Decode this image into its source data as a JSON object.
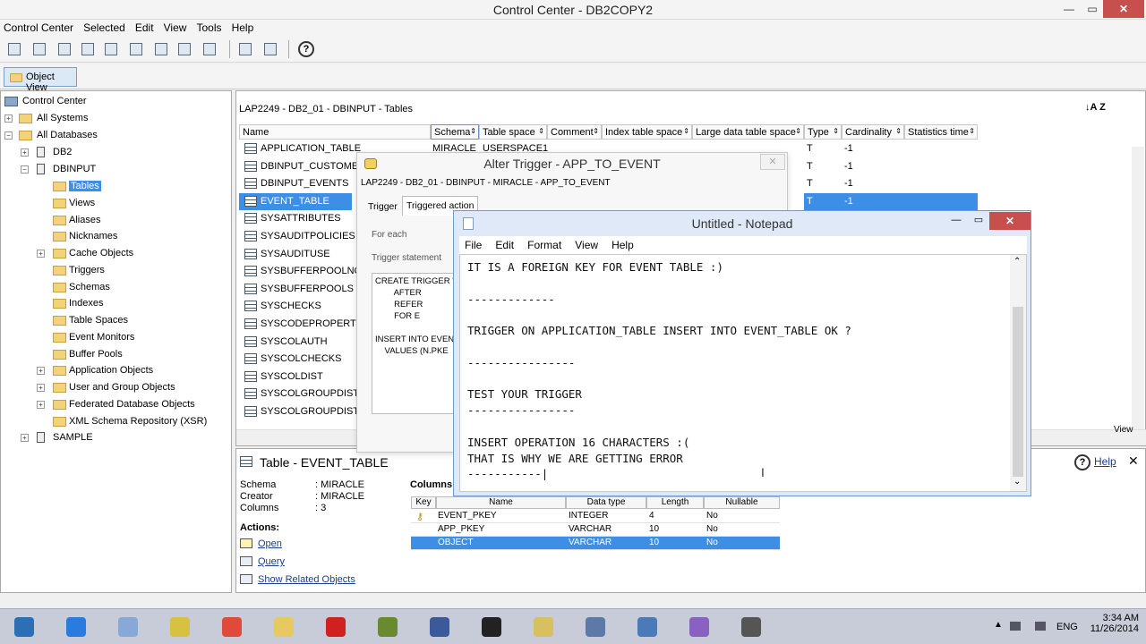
{
  "window": {
    "title": "Control Center - DB2COPY2",
    "min": "—",
    "max": "▭",
    "close": "✕"
  },
  "menu": [
    "Control Center",
    "Selected",
    "Edit",
    "View",
    "Tools",
    "Help"
  ],
  "toolbar_icons": [
    "tree-icon",
    "systems-icon",
    "instance-icon",
    "database-icon",
    "tables-icon",
    "command-icon",
    "script-icon",
    "task-icon",
    "journal-icon",
    "license-icon",
    "settings-icon",
    "list-icon",
    "help-icon"
  ],
  "object_view_label": "Object View",
  "tree": {
    "root": "Control Center",
    "all_systems": "All Systems",
    "all_databases": "All Databases",
    "db2": "DB2",
    "dbinput": "DBINPUT",
    "items": [
      "Tables",
      "Views",
      "Aliases",
      "Nicknames",
      "Cache Objects",
      "Triggers",
      "Schemas",
      "Indexes",
      "Table Spaces",
      "Event Monitors",
      "Buffer Pools",
      "Application Objects",
      "User and Group Objects",
      "Federated Database Objects",
      "XML Schema Repository (XSR)"
    ],
    "sample": "SAMPLE"
  },
  "contents": {
    "breadcrumb": "LAP2249 - DB2_01 - DBINPUT - Tables",
    "sort_icon": "↓A Z",
    "columns": [
      "Name",
      "Schema",
      "Table space",
      "Comment",
      "Index table space",
      "Large data table space",
      "Type",
      "Cardinality",
      "Statistics time"
    ],
    "rows": [
      {
        "name": "APPLICATION_TABLE",
        "schema": "MIRACLE",
        "tablespace": "USERSPACE1",
        "type": "T",
        "card": "-1"
      },
      {
        "name": "DBINPUT_CUSTOMER",
        "type": "T",
        "card": "-1"
      },
      {
        "name": "DBINPUT_EVENTS",
        "type": "T",
        "card": "-1"
      },
      {
        "name": "EVENT_TABLE",
        "type": "T",
        "card": "-1"
      },
      {
        "name": "SYSATTRIBUTES"
      },
      {
        "name": "SYSAUDITPOLICIES"
      },
      {
        "name": "SYSAUDITUSE"
      },
      {
        "name": "SYSBUFFERPOOLNODES"
      },
      {
        "name": "SYSBUFFERPOOLS"
      },
      {
        "name": "SYSCHECKS"
      },
      {
        "name": "SYSCODEPROPERTIES"
      },
      {
        "name": "SYSCOLAUTH"
      },
      {
        "name": "SYSCOLCHECKS"
      },
      {
        "name": "SYSCOLDIST"
      },
      {
        "name": "SYSCOLGROUPDIST"
      },
      {
        "name": "SYSCOLGROUPDISTCO"
      }
    ],
    "view_label": "View"
  },
  "details": {
    "title": "Table - EVENT_TABLE",
    "help": "Help",
    "schema_label": "Schema",
    "schema": ": MIRACLE",
    "creator_label": "Creator",
    "creator": ": MIRACLE",
    "columns_label": "Columns",
    "columns": ": 3",
    "actions": "Actions:",
    "open": "Open",
    "query": "Query",
    "related": "Show Related Objects",
    "col_table_title": "Columns",
    "col_headers": [
      "Key",
      "Name",
      "Data type",
      "Length",
      "Nullable"
    ],
    "col_rows": [
      {
        "name": "EVENT_PKEY",
        "type": "INTEGER",
        "len": "4",
        "null": "No"
      },
      {
        "name": "APP_PKEY",
        "type": "VARCHAR",
        "len": "10",
        "null": "No"
      },
      {
        "name": "OBJECT",
        "type": "VARCHAR",
        "len": "10",
        "null": "No"
      }
    ]
  },
  "trigger": {
    "title": "Alter Trigger - APP_TO_EVENT",
    "crumb": "LAP2249 - DB2_01 - DBINPUT - MIRACLE - APP_TO_EVENT",
    "tab1": "Trigger",
    "tab2": "Triggered action",
    "for_each": "For each",
    "trigger_statement": "Trigger statement",
    "sql": [
      "CREATE TRIGGER \"",
      "        AFTER",
      "        REFER",
      "        FOR E",
      "",
      "INSERT INTO EVENT",
      "    VALUES (N.PKE"
    ]
  },
  "notepad": {
    "title": "Untitled - Notepad",
    "menu": [
      "File",
      "Edit",
      "Format",
      "View",
      "Help"
    ],
    "text": "IT IS A FOREIGN KEY FOR EVENT TABLE :)\n\n-------------\n\nTRIGGER ON APPLICATION_TABLE INSERT INTO EVENT_TABLE OK ?\n\n----------------\n\nTEST YOUR TRIGGER\n----------------\n\nINSERT OPERATION 16 CHARACTERS :(\nTHAT IS WHY WE ARE GETTING ERROR\n-----------|"
  },
  "taskbar": {
    "apps": [
      "start-icon",
      "ie-icon",
      "explorer-icon",
      "notepad-icon",
      "chrome-icon",
      "files-icon",
      "opera-icon",
      "editor-icon",
      "player-icon",
      "cmd-icon",
      "db-icon",
      "control-center-icon",
      "remote-icon",
      "network-icon",
      "window-icon"
    ],
    "lang": "ENG",
    "time": "3:34 AM",
    "date": "11/26/2014"
  }
}
